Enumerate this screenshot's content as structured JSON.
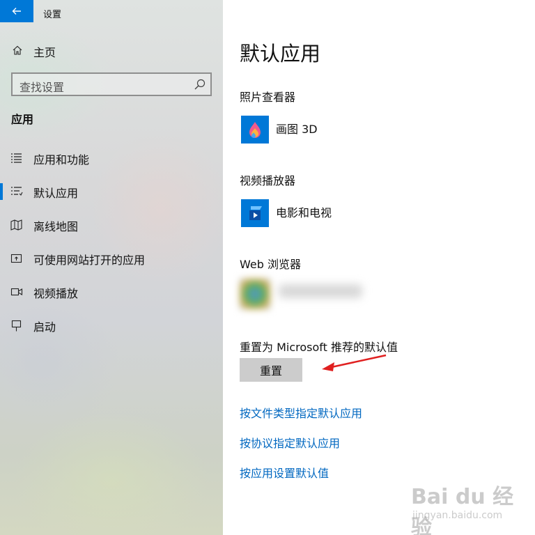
{
  "window": {
    "title": "设置"
  },
  "nav": {
    "home_label": "主页",
    "search_placeholder": "查找设置",
    "section_title": "应用",
    "items": [
      {
        "label": "应用和功能",
        "icon": "list-icon",
        "selected": false
      },
      {
        "label": "默认应用",
        "icon": "default-apps-icon",
        "selected": true
      },
      {
        "label": "离线地图",
        "icon": "map-icon",
        "selected": false
      },
      {
        "label": "可使用网站打开的应用",
        "icon": "open-in-app-icon",
        "selected": false
      },
      {
        "label": "视频播放",
        "icon": "video-icon",
        "selected": false
      },
      {
        "label": "启动",
        "icon": "startup-icon",
        "selected": false
      }
    ]
  },
  "content": {
    "page_title": "默认应用",
    "groups": [
      {
        "label": "照片查看器",
        "app_name": "画图 3D",
        "app_icon": "paint3d-icon"
      },
      {
        "label": "视频播放器",
        "app_name": "电影和电视",
        "app_icon": "movies-tv-icon"
      },
      {
        "label": "Web 浏览器",
        "app_icon": "browser-icon"
      }
    ],
    "reset_text": "重置为 Microsoft 推荐的默认值",
    "reset_button": "重置",
    "links": [
      "按文件类型指定默认应用",
      "按协议指定默认应用",
      "按应用设置默认值"
    ]
  },
  "colors": {
    "accent": "#0078d7",
    "link": "#0067c0",
    "button_bg": "#cccccc",
    "annotation_arrow": "#e02020"
  },
  "watermark": {
    "line1": "Bai du 经验",
    "line2": "jingyan.baidu.com"
  }
}
